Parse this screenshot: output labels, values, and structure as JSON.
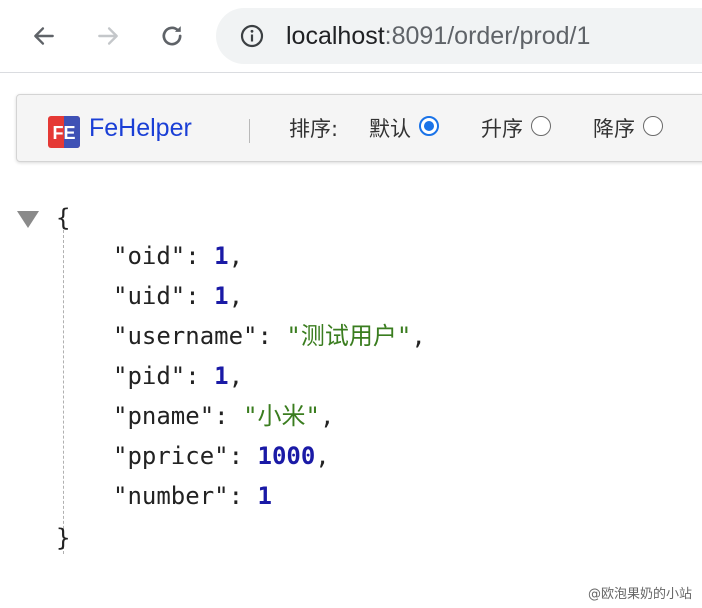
{
  "browser": {
    "url_host": "localhost",
    "url_rest": ":8091/order/prod/1",
    "back_icon": "arrow-left-icon",
    "forward_icon": "arrow-right-icon",
    "reload_icon": "reload-icon",
    "info_icon": "info-icon"
  },
  "fehelper": {
    "logo_text": "FE",
    "title": "FeHelper",
    "sort_label": "排序:",
    "options": [
      {
        "label": "默认",
        "checked": true
      },
      {
        "label": "升序",
        "checked": false
      },
      {
        "label": "降序",
        "checked": false
      }
    ],
    "accent_color": "#1a73e8"
  },
  "json": {
    "open_brace": "{",
    "close_brace": "}",
    "entries": [
      {
        "key": "\"oid\"",
        "value": "1",
        "type": "number",
        "comma": ","
      },
      {
        "key": "\"uid\"",
        "value": "1",
        "type": "number",
        "comma": ","
      },
      {
        "key": "\"username\"",
        "value": "\"测试用户\"",
        "type": "string",
        "comma": ","
      },
      {
        "key": "\"pid\"",
        "value": "1",
        "type": "number",
        "comma": ","
      },
      {
        "key": "\"pname\"",
        "value": "\"小米\"",
        "type": "string",
        "comma": ","
      },
      {
        "key": "\"pprice\"",
        "value": "1000",
        "type": "number",
        "comma": ","
      },
      {
        "key": "\"number\"",
        "value": "1",
        "type": "number",
        "comma": ""
      }
    ]
  },
  "watermark": "@欧泡果奶的小站"
}
